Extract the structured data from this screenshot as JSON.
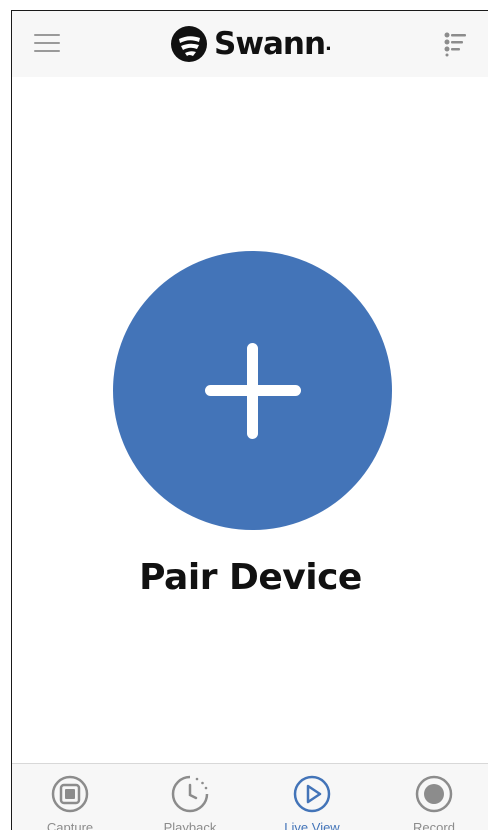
{
  "header": {
    "logo_text": "Swann",
    "logo_mark": ".",
    "menu_icon": "hamburger-menu-icon",
    "filter_icon": "list-filter-icon"
  },
  "main": {
    "pair_button_icon": "plus-icon",
    "pair_label": "Pair Device"
  },
  "tabs": [
    {
      "label": "Capture",
      "icon": "capture-icon",
      "active": false
    },
    {
      "label": "Playback",
      "icon": "playback-clock-icon",
      "active": false
    },
    {
      "label": "Live View",
      "icon": "play-icon",
      "active": true
    },
    {
      "label": "Record",
      "icon": "record-icon",
      "active": false
    }
  ],
  "colors": {
    "accent": "#4374b8",
    "header_bg": "#f7f7f7",
    "icon_gray": "#8c8c8c",
    "text_dark": "#111111"
  }
}
